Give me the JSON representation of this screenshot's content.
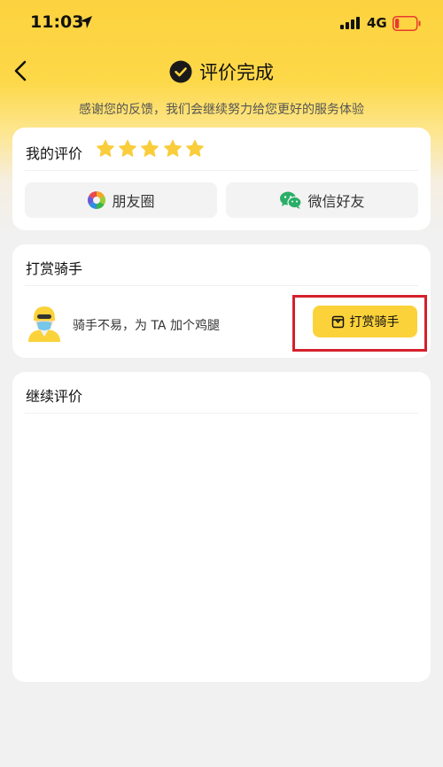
{
  "status_bar": {
    "time": "11:03",
    "network": "4G",
    "battery_level": 0.12,
    "battery_color": "#e63b2e"
  },
  "nav": {
    "back_icon": "chevron-left-icon",
    "title_icon": "check-circle-icon",
    "title": "评价完成"
  },
  "subtitle": "感谢您的反馈，我们会继续努力给您更好的服务体验",
  "rating_card": {
    "label": "我的评价",
    "stars_filled": 5,
    "stars_total": 5,
    "star_color": "#f9cd3b",
    "share_buttons": [
      {
        "label": "朋友圈",
        "icon": "moments-icon"
      },
      {
        "label": "微信好友",
        "icon": "wechat-icon"
      }
    ]
  },
  "tip_card": {
    "title": "打赏骑手",
    "avatar_icon": "rider-avatar-icon",
    "message": "骑手不易，为 TA 加个鸡腿",
    "button_label": "打赏骑手",
    "button_icon": "gift-box-icon",
    "button_color": "#fbd23a"
  },
  "continue_card": {
    "title": "继续评价"
  },
  "colors": {
    "accent": "#fdd23f",
    "highlight": "#d4202b"
  }
}
